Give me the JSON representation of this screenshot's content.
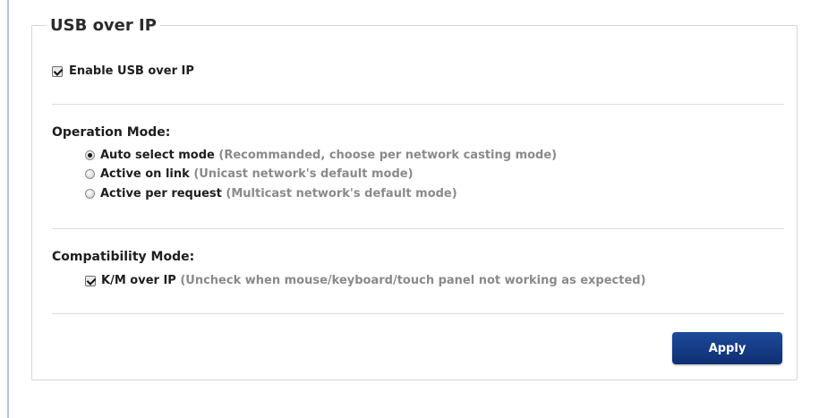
{
  "section": {
    "title": "USB over IP"
  },
  "enable": {
    "label": "Enable USB over IP",
    "checked": true
  },
  "operation_mode": {
    "heading": "Operation Mode:",
    "options": [
      {
        "label": "Auto select mode",
        "hint": "(Recommanded, choose per network casting mode)",
        "selected": true
      },
      {
        "label": "Active on link",
        "hint": "(Unicast network's default mode)",
        "selected": false
      },
      {
        "label": "Active per request",
        "hint": "(Multicast network's default mode)",
        "selected": false
      }
    ]
  },
  "compatibility_mode": {
    "heading": "Compatibility Mode:",
    "km_label": "K/M over IP",
    "km_hint": "(Uncheck when mouse/keyboard/touch panel not working as expected)",
    "km_checked": true
  },
  "actions": {
    "apply_label": "Apply"
  },
  "colors": {
    "button": "#163f88",
    "hint_text": "#8a8a8a",
    "left_rule": "#b7c7dc"
  }
}
